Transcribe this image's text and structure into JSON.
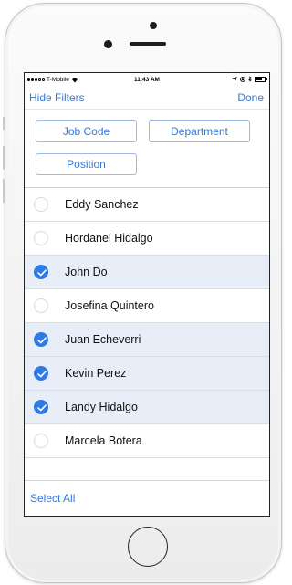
{
  "status": {
    "carrier": "T-Mobile",
    "time": "11:43 AM"
  },
  "nav": {
    "left_label": "Hide Filters",
    "right_label": "Done"
  },
  "filters": {
    "job_code": "Job Code",
    "department": "Department",
    "position": "Position"
  },
  "employees": [
    {
      "name": "Eddy Sanchez",
      "selected": false
    },
    {
      "name": "Hordanel Hidalgo",
      "selected": false
    },
    {
      "name": "John Do",
      "selected": true
    },
    {
      "name": "Josefina Quintero",
      "selected": false
    },
    {
      "name": "Juan Echeverri",
      "selected": true
    },
    {
      "name": "Kevin Perez",
      "selected": true
    },
    {
      "name": "Landy Hidalgo",
      "selected": true
    },
    {
      "name": "Marcela Botera",
      "selected": false
    }
  ],
  "footer": {
    "select_all": "Select All"
  },
  "colors": {
    "accent": "#3478d8",
    "selected_row": "#e8eef8",
    "check_fill": "#2f7ae5"
  }
}
